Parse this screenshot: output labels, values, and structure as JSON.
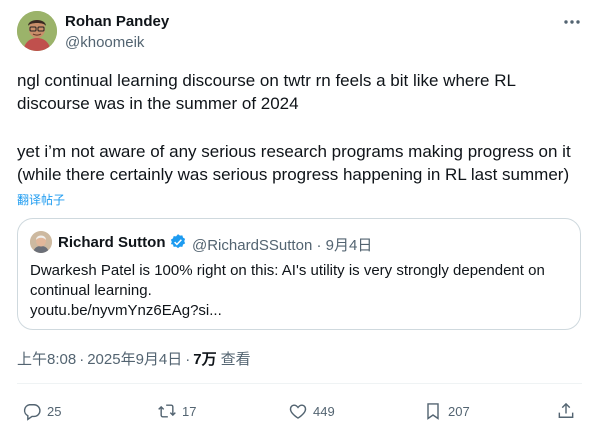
{
  "author": {
    "name": "Rohan Pandey",
    "handle": "@khoomeik"
  },
  "tweet": {
    "paragraph1_line1": "ngl continual learning discourse on twtr rn feels a bit like where RL",
    "paragraph1_line2": "discourse was in the summer of 2024",
    "paragraph2_line1": "yet i’m not aware of any serious research programs making progress on it",
    "paragraph2_line2": "(while there certainly was serious progress happening in RL last summer)",
    "translate_label": "翻译帖子"
  },
  "quote": {
    "name": "Richard Sutton",
    "handle": "@RichardSSutton",
    "separator": "·",
    "date": "9月4日",
    "text": "Dwarkesh Patel is 100% right on this: AI's utility is very strongly dependent on continual learning.",
    "link": "youtu.be/nyvmYnz6EAg?si..."
  },
  "meta": {
    "time": "上午8:08",
    "separator": "·",
    "date": "2025年9月4日",
    "views_count": "7万",
    "views_label": "查看"
  },
  "actions": {
    "replies": "25",
    "retweets": "17",
    "likes": "449",
    "bookmarks": "207"
  },
  "colors": {
    "accent": "#1d9bf0",
    "secondary_text": "#536471",
    "border": "#cfd9de"
  },
  "icons": [
    "more-icon",
    "verified-badge-icon",
    "reply-icon",
    "retweet-icon",
    "like-icon",
    "bookmark-icon",
    "share-icon"
  ]
}
